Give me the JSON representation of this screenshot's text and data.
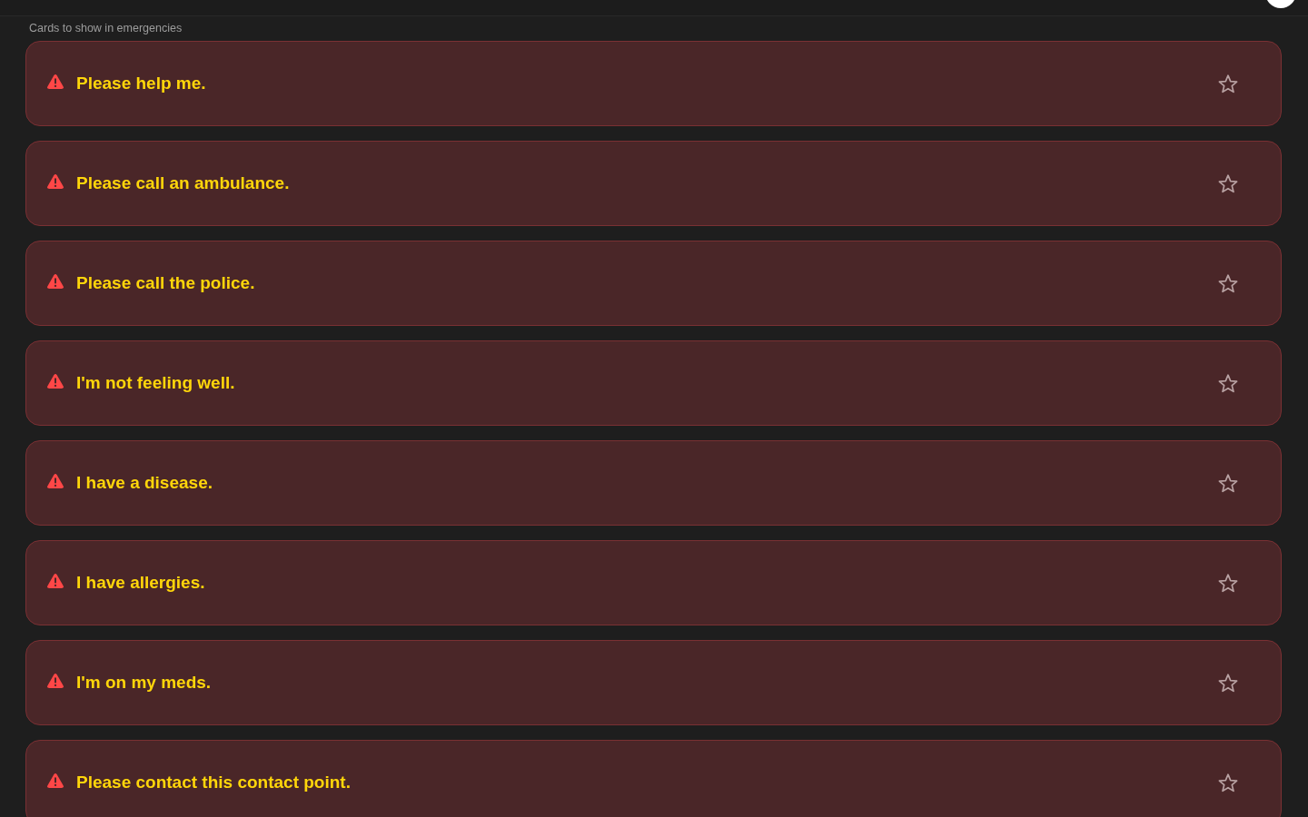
{
  "header_label": "Cards to show in emergencies",
  "cards": [
    {
      "text": "Please help me.",
      "starred": false
    },
    {
      "text": "Please call an ambulance.",
      "starred": false
    },
    {
      "text": "Please call the police.",
      "starred": false
    },
    {
      "text": "I'm not feeling well.",
      "starred": false
    },
    {
      "text": "I have a disease.",
      "starred": false
    },
    {
      "text": "I have allergies.",
      "starred": false
    },
    {
      "text": "I'm on my meds.",
      "starred": false
    },
    {
      "text": "Please contact this contact point.",
      "starred": false
    }
  ]
}
